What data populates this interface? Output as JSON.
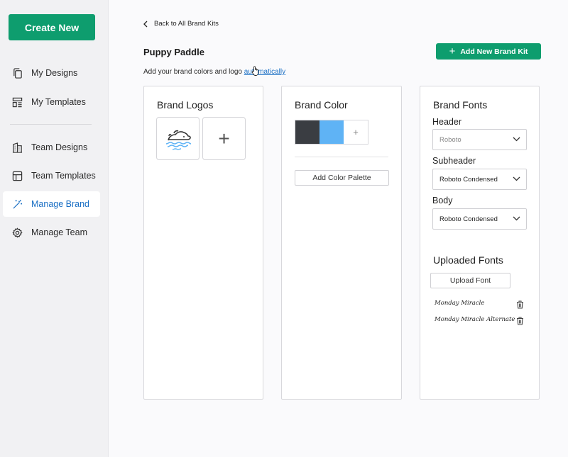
{
  "sidebar": {
    "create_label": "Create New",
    "items": [
      {
        "label": "My Designs",
        "icon": "copy-icon"
      },
      {
        "label": "My Templates",
        "icon": "templates-icon"
      },
      {
        "label": "Team Designs",
        "icon": "building-icon"
      },
      {
        "label": "Team Templates",
        "icon": "table-icon"
      },
      {
        "label": "Manage Brand",
        "icon": "magic-wand-icon",
        "active": true
      },
      {
        "label": "Manage Team",
        "icon": "gear-icon"
      }
    ]
  },
  "header": {
    "back_label": "Back to All Brand Kits",
    "kit_name": "Puppy Paddle",
    "add_kit_label": "Add New Brand Kit",
    "subtitle_prefix": "Add your brand colors and logo ",
    "subtitle_link": "automatically"
  },
  "logos": {
    "title": "Brand Logos",
    "add_symbol": "+"
  },
  "colors": {
    "title": "Brand Color",
    "swatches": [
      "#3a3d42",
      "#5fb3f5"
    ],
    "add_symbol": "+",
    "palette_label": "Add Color Palette"
  },
  "fonts": {
    "title": "Brand Fonts",
    "header_label": "Header",
    "header_value": "Roboto",
    "subheader_label": "Subheader",
    "subheader_value": "Roboto Condensed",
    "body_label": "Body",
    "body_value": "Roboto Condensed",
    "uploaded_title": "Uploaded Fonts",
    "upload_label": "Upload Font",
    "uploaded": [
      "Monday Miracle",
      "Monday Miracle Alternate"
    ]
  },
  "theme": {
    "accent": "#0e9d6e",
    "link": "#1a6fc4"
  }
}
